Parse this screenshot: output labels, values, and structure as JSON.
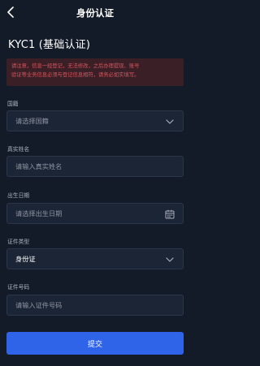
{
  "header": {
    "title": "身份认证",
    "back_icon": "chevron-left-icon"
  },
  "heading": "KYC1 (基础认证)",
  "notice": {
    "line1": "请注意，信息一经登记，无法修改，之后办理提现、账号",
    "line2": "验证等业务信息必须与登记信息相符，请务必如实填写。",
    "color": "#d8535d"
  },
  "form": {
    "country": {
      "label": "国籍",
      "placeholder": "请选择国籍",
      "icon": "chevron-down-icon"
    },
    "name": {
      "label": "真实姓名",
      "placeholder": "请输入真实姓名"
    },
    "birthday": {
      "label": "出生日期",
      "placeholder": "请选择出生日期",
      "icon": "calendar-icon"
    },
    "id_type": {
      "label": "证件类型",
      "value": "身份证",
      "icon": "chevron-down-icon"
    },
    "id_number": {
      "label": "证件号码",
      "placeholder": "请输入证件号码"
    }
  },
  "submit_label": "提交",
  "colors": {
    "background": "#141b28",
    "accent": "#2f64e8",
    "field": "#1c2535"
  }
}
